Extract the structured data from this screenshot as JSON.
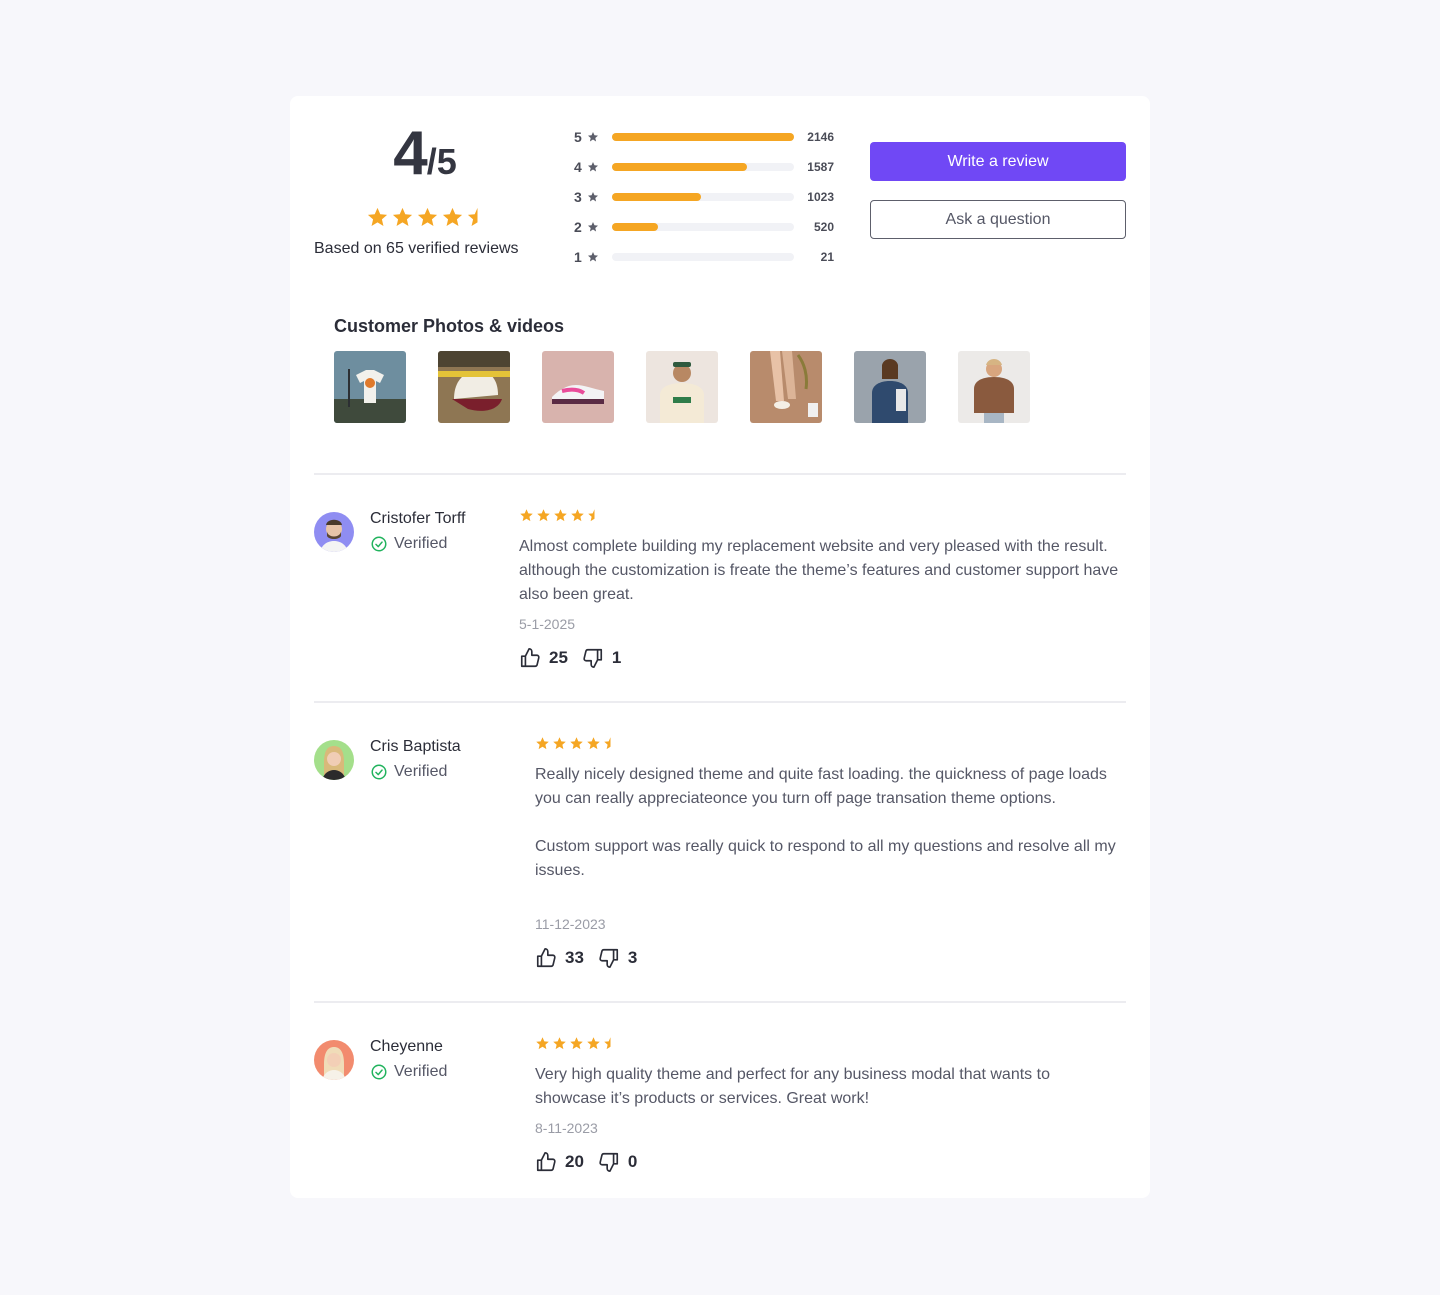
{
  "summary": {
    "score": "4",
    "out_of": "/5",
    "stars": 4.5,
    "based_on": "Based on 65 verified reviews"
  },
  "distribution": [
    {
      "stars": "5",
      "count": "2146",
      "fill": 1.0
    },
    {
      "stars": "4",
      "count": "1587",
      "fill": 0.74
    },
    {
      "stars": "3",
      "count": "1023",
      "fill": 0.49
    },
    {
      "stars": "2",
      "count": "520",
      "fill": 0.25
    },
    {
      "stars": "1",
      "count": "21",
      "fill": 0.0
    }
  ],
  "actions": {
    "write_label": "Write a review",
    "ask_label": "Ask a question"
  },
  "photos": {
    "title": "Customer Photos & videos",
    "items": [
      "tshirt-photo",
      "cap-photo",
      "sneaker-photo",
      "man-tee-photo",
      "legs-photo",
      "woman-jacket-photo",
      "sweater-photo"
    ]
  },
  "reviews": [
    {
      "name": "Cristofer Torff",
      "verified": "Verified",
      "stars": 4.5,
      "paragraphs": [
        "Almost complete building my replacement website and very pleased with the result. although the customization is freate the theme’s features and customer support have also been great."
      ],
      "date": "5-1-2025",
      "likes": "25",
      "dislikes": "1"
    },
    {
      "name": "Cris Baptista",
      "verified": "Verified",
      "stars": 4.5,
      "paragraphs": [
        "Really nicely designed theme and quite fast loading. the quickness of page loads you can really appreciateonce you turn off page transation theme options.",
        "Custom support was really quick to respond to all my questions and resolve all my issues."
      ],
      "date": "11-12-2023",
      "likes": "33",
      "dislikes": "3"
    },
    {
      "name": "Cheyenne",
      "verified": "Verified",
      "stars": 4.5,
      "paragraphs": [
        "Very high quality theme and perfect for any business modal that wants to showcase it’s products or services. Great work!"
      ],
      "date": "8-11-2023",
      "likes": "20",
      "dislikes": "0"
    }
  ],
  "colors": {
    "accent": "#7048f5",
    "star": "#f5a623",
    "verified": "#22b35e"
  }
}
